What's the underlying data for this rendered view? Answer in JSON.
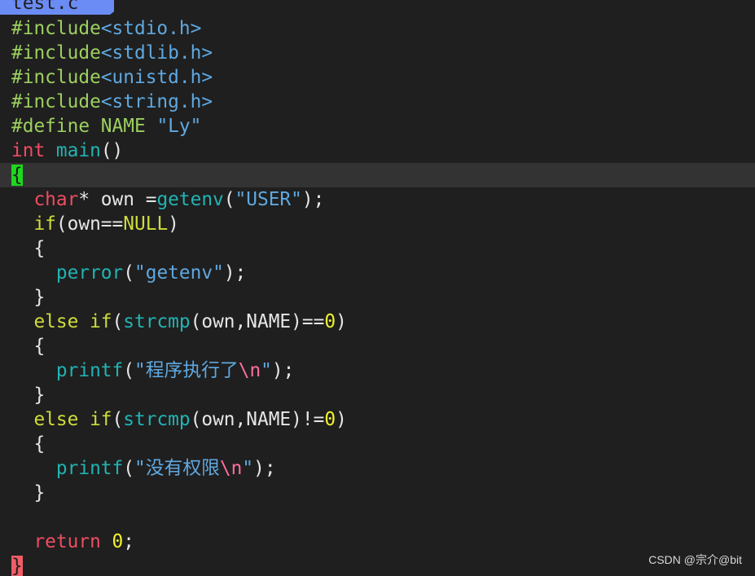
{
  "tab": {
    "filename": "test.c"
  },
  "code": {
    "l1": [
      "#include",
      "<stdio.h>"
    ],
    "l2": [
      "#include",
      "<stdlib.h>"
    ],
    "l3": [
      "#include",
      "<unistd.h>"
    ],
    "l4": [
      "#include",
      "<string.h>"
    ],
    "l5": [
      "#define",
      " NAME ",
      "\"Ly\""
    ],
    "l6": [
      "int",
      " ",
      "main",
      "()"
    ],
    "l7": [
      "{"
    ],
    "l8": [
      "  ",
      "char",
      "* own =",
      "getenv",
      "(",
      "\"USER\"",
      ");"
    ],
    "l9": [
      "  ",
      "if",
      "(own==",
      "NULL",
      ")"
    ],
    "l10": [
      "  {"
    ],
    "l11": [
      "    ",
      "perror",
      "(",
      "\"getenv\"",
      ");"
    ],
    "l12": [
      "  }"
    ],
    "l13": [
      "  ",
      "else if",
      "(",
      "strcmp",
      "(own,NAME)==",
      "0",
      ")"
    ],
    "l14": [
      "  {"
    ],
    "l15": [
      "    ",
      "printf",
      "(",
      "\"程序执行了",
      "\\n",
      "\"",
      ");"
    ],
    "l16": [
      "  }"
    ],
    "l17": [
      "  ",
      "else if",
      "(",
      "strcmp",
      "(own,NAME)!=",
      "0",
      ")"
    ],
    "l18": [
      "  {"
    ],
    "l19": [
      "    ",
      "printf",
      "(",
      "\"没有权限",
      "\\n",
      "\"",
      ");"
    ],
    "l20": [
      "  }"
    ],
    "l21": [
      ""
    ],
    "l22": [
      "  ",
      "return",
      " ",
      "0",
      ";"
    ],
    "l23": [
      "}"
    ]
  },
  "watermark": "CSDN @宗介@bit"
}
